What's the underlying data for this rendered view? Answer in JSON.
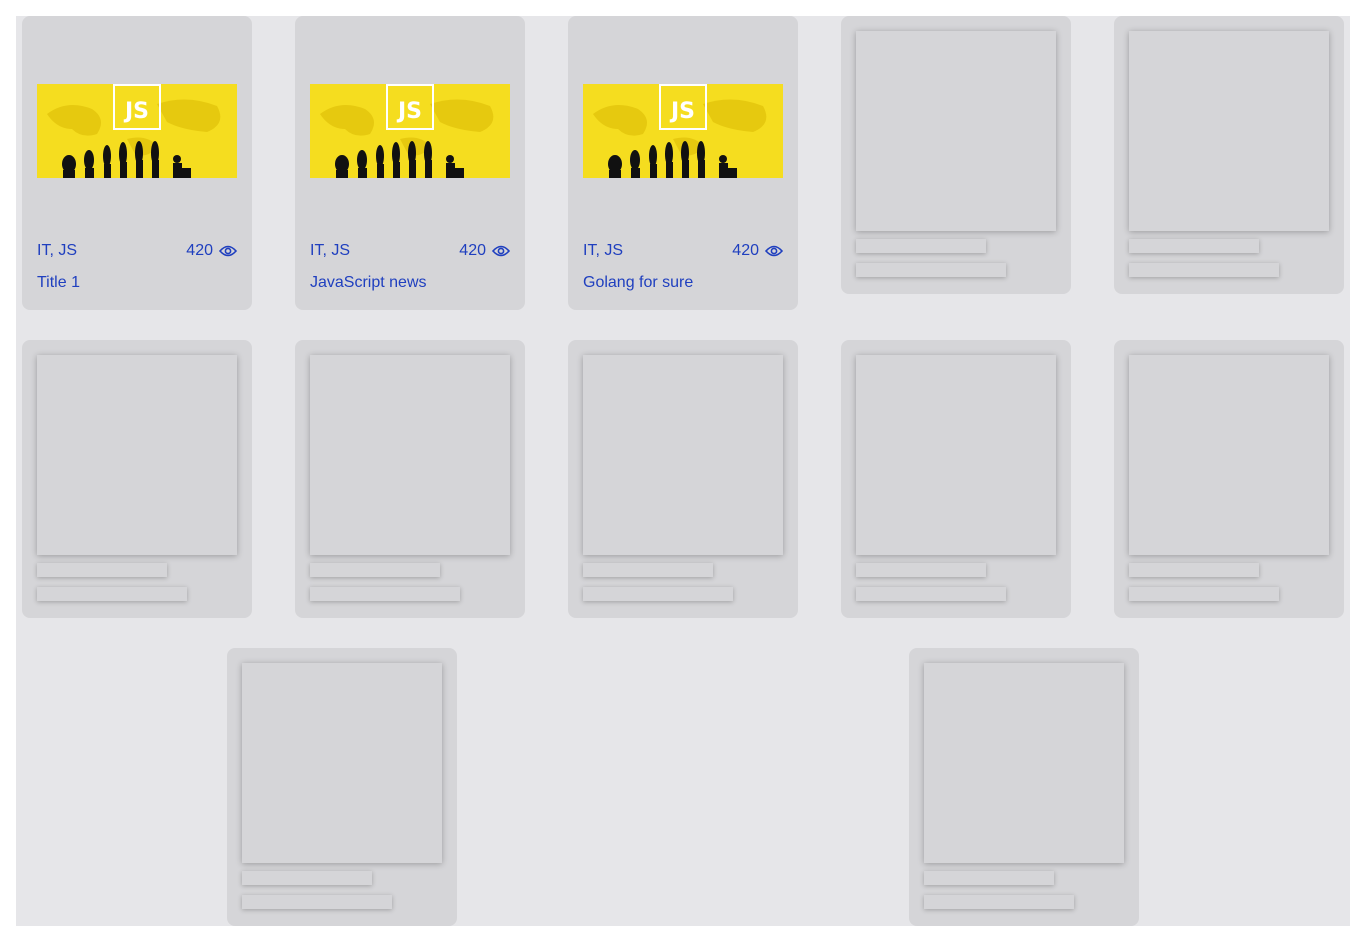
{
  "articles": [
    {
      "tags": "IT, JS",
      "views": "420",
      "title": "Title 1",
      "logo_text": "JS"
    },
    {
      "tags": "IT, JS",
      "views": "420",
      "title": "JavaScript news",
      "logo_text": "JS"
    },
    {
      "tags": "IT, JS",
      "views": "420",
      "title": "Golang for sure",
      "logo_text": "JS"
    }
  ],
  "icons": {
    "views": "eye-icon"
  },
  "colors": {
    "page_background": "#e6e6e9",
    "card_background": "#d5d5d8",
    "link_text": "#1f3fbf",
    "thumbnail_yellow": "#f5dd1f"
  }
}
